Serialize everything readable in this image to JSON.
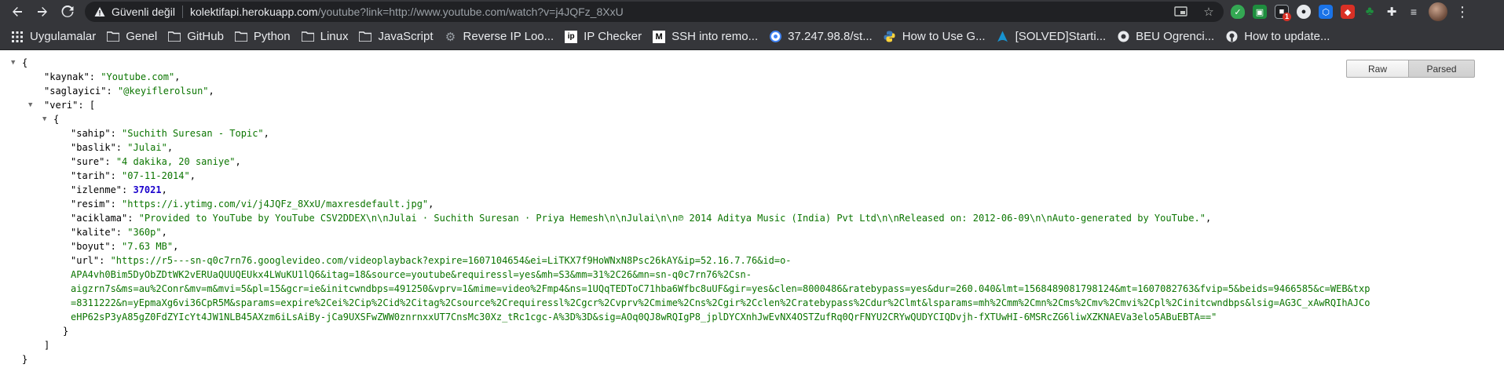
{
  "omnibox": {
    "security_label": "Güvenli değil",
    "host": "kolektifapi.herokuapp.com",
    "path": "/youtube?link=http://www.youtube.com/watch?v=j4JQFz_8XxU"
  },
  "extensions": {
    "badge_count": "1"
  },
  "bookmarks": [
    {
      "label": "Uygulamalar",
      "icon": "apps-grid-icon"
    },
    {
      "label": "Genel",
      "icon": "folder-icon"
    },
    {
      "label": "GitHub",
      "icon": "folder-icon"
    },
    {
      "label": "Python",
      "icon": "folder-icon"
    },
    {
      "label": "Linux",
      "icon": "folder-icon"
    },
    {
      "label": "JavaScript",
      "icon": "folder-icon"
    },
    {
      "label": "Reverse IP Loo...",
      "icon": "gear-icon"
    },
    {
      "label": "IP Checker",
      "icon": "ip-icon"
    },
    {
      "label": "SSH into remo...",
      "icon": "medium-icon"
    },
    {
      "label": "37.247.98.8/st...",
      "icon": "globe-icon"
    },
    {
      "label": "How to Use G...",
      "icon": "python-icon"
    },
    {
      "label": "[SOLVED]Starti...",
      "icon": "arch-icon"
    },
    {
      "label": "BEU Ogrenci...",
      "icon": "circle-icon"
    },
    {
      "label": "How to update...",
      "icon": "github-icon"
    }
  ],
  "json_viewer": {
    "raw_label": "Raw",
    "parsed_label": "Parsed",
    "keys": {
      "kaynak": "\"kaynak\"",
      "saglayici": "\"saglayici\"",
      "veri": "\"veri\"",
      "sahip": "\"sahip\"",
      "baslik": "\"baslik\"",
      "sure": "\"sure\"",
      "tarih": "\"tarih\"",
      "izlenme": "\"izlenme\"",
      "resim": "\"resim\"",
      "aciklama": "\"aciklama\"",
      "kalite": "\"kalite\"",
      "boyut": "\"boyut\"",
      "url": "\"url\""
    },
    "values": {
      "kaynak": "\"Youtube.com\"",
      "saglayici": "\"@keyiflerolsun\"",
      "sahip": "\"Suchith Suresan - Topic\"",
      "baslik": "\"Julai\"",
      "sure": "\"4 dakika, 20 saniye\"",
      "tarih": "\"07-11-2014\"",
      "izlenme": "37021",
      "resim": "\"https://i.ytimg.com/vi/j4JQFz_8XxU/maxresdefault.jpg\"",
      "aciklama": "\"Provided to YouTube by YouTube CSV2DDEX\\n\\nJulai · Suchith Suresan · Priya Hemesh\\n\\nJulai\\n\\n℗ 2014 Aditya Music (India) Pvt Ltd\\n\\nReleased on: 2012-06-09\\n\\nAuto-generated by YouTube.\"",
      "kalite": "\"360p\"",
      "boyut": "\"7.63 MB\"",
      "url_lines": [
        "\"https://r5---sn-q0c7rn76.googlevideo.com/videoplayback?expire=1607104654&ei=LiTKX7f9HoWNxN8Psc26kAY&ip=52.16.7.76&id=o-",
        "APA4vh0Bim5DyObZDtWK2vERUaQUUQEUkx4LWuKU1lQ6&itag=18&source=youtube&requiressl=yes&mh=S3&mm=31%2C26&mn=sn-q0c7rn76%2Csn-",
        "aigzrn7s&ms=au%2Conr&mv=m&mvi=5&pl=15&gcr=ie&initcwndbps=491250&vprv=1&mime=video%2Fmp4&ns=1UQqTEDToC71hba6Wfbc8uUF&gir=yes&clen=8000486&ratebypass=yes&dur=260.040&lmt=1568489081798124&mt=1607082763&fvip=5&beids=9466585&c=WEB&txp",
        "=8311222&n=yEpmaXg6vi36CpR5M&sparams=expire%2Cei%2Cip%2Cid%2Citag%2Csource%2Crequiressl%2Cgcr%2Cvprv%2Cmime%2Cns%2Cgir%2Cclen%2Cratebypass%2Cdur%2Clmt&lsparams=mh%2Cmm%2Cmn%2Cms%2Cmv%2Cmvi%2Cpl%2Cinitcwndbps&lsig=AG3C_xAwRQIhAJCo",
        "eHP62sP3yA85gZ0FdZYIcYt4JW1NLB45AXzm6iLsAiBy-jCa9UXSFwZWW0znrnxxUT7CnsMc30Xz_tRc1cgc-A%3D%3D&sig=AOq0QJ8wRQIgP8_jplDYCXnhJwEvNX4OSTZufRq0QrFNYU2CRYwQUDYCIQDvjh-fXTUwHI-6MSRcZG6liwXZKNAEVa3elo5ABuEBTA==\""
      ]
    },
    "punct": {
      "open_brace": "{",
      "close_brace": "}",
      "open_bracket": "[",
      "close_bracket": "]"
    }
  }
}
